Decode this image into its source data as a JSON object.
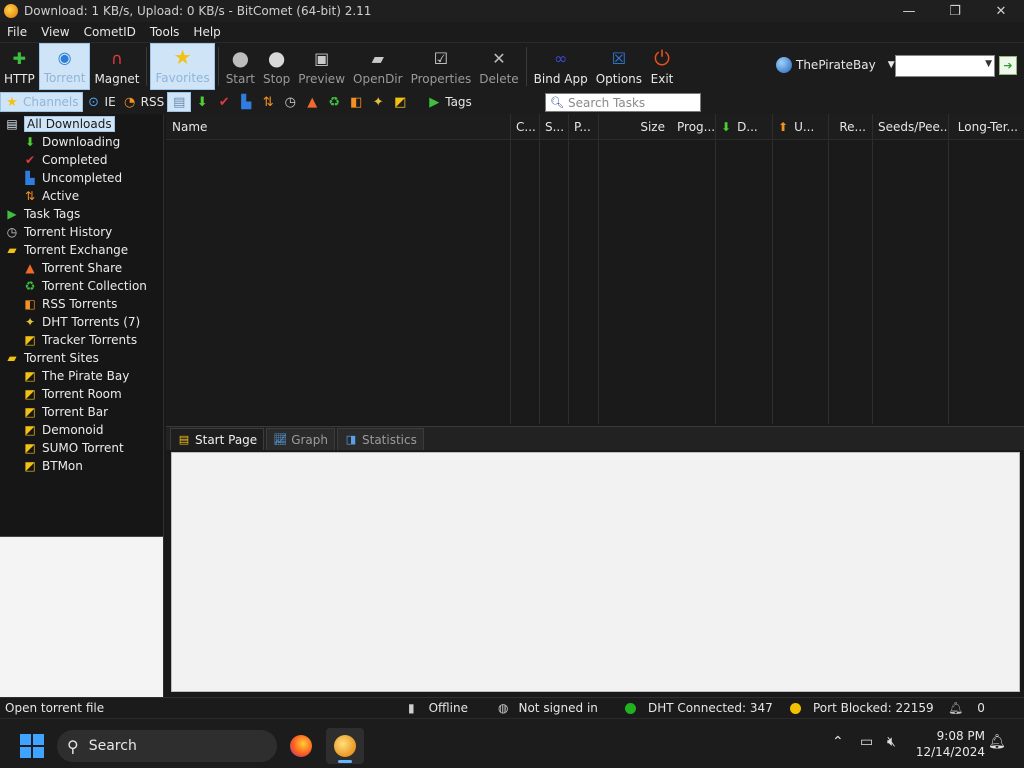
{
  "window": {
    "title": "Download: 1 KB/s, Upload: 0 KB/s - BitComet (64-bit) 2.11",
    "controls": [
      "—",
      "❐",
      "✕"
    ]
  },
  "menu": [
    "File",
    "View",
    "CometID",
    "Tools",
    "Help"
  ],
  "toolbar": {
    "buttons": [
      {
        "label": "HTTP",
        "icon": "http-add-icon"
      },
      {
        "label": "Torrent",
        "icon": "torrent-icon"
      },
      {
        "label": "Magnet",
        "icon": "magnet-icon"
      },
      {
        "label": "Favorites",
        "icon": "star-icon"
      },
      {
        "label": "Start",
        "icon": "play-icon"
      },
      {
        "label": "Stop",
        "icon": "stop-icon"
      },
      {
        "label": "Preview",
        "icon": "preview-icon"
      },
      {
        "label": "OpenDir",
        "icon": "folder-icon"
      },
      {
        "label": "Properties",
        "icon": "properties-icon"
      },
      {
        "label": "Delete",
        "icon": "delete-icon"
      },
      {
        "label": "Bind App",
        "icon": "bind-app-icon"
      },
      {
        "label": "Options",
        "icon": "options-icon"
      },
      {
        "label": "Exit",
        "icon": "exit-icon"
      }
    ],
    "site_select": "ThePirateBay",
    "site_search_value": ""
  },
  "subbar": {
    "channels": "Channels",
    "ie": "IE",
    "rss": "RSS",
    "tags": "Tags",
    "search_placeholder": "Search Tasks"
  },
  "sidebar": {
    "all_downloads": "All Downloads",
    "downloading": "Downloading",
    "completed": "Completed",
    "uncompleted": "Uncompleted",
    "active": "Active",
    "task_tags": "Task Tags",
    "torrent_history": "Torrent History",
    "torrent_exchange": "Torrent Exchange",
    "torrent_share": "Torrent Share",
    "torrent_collection": "Torrent Collection",
    "rss_torrents": "RSS Torrents",
    "dht_torrents": "DHT Torrents (7)",
    "tracker_torrents": "Tracker Torrents",
    "torrent_sites": "Torrent Sites",
    "the_pirate_bay": "The Pirate Bay",
    "torrent_room": "Torrent Room",
    "torrent_bar": "Torrent Bar",
    "demonoid": "Demonoid",
    "sumo_torrent": "SUMO Torrent",
    "btmon": "BTMon"
  },
  "tasklist": {
    "columns": [
      "Name",
      "C...",
      "S...",
      "P...",
      "Size",
      "Prog...",
      "D...",
      "U...",
      "Re...",
      "Seeds/Pee...",
      "Long-Ter..."
    ]
  },
  "tabs": [
    "Start Page",
    "Graph",
    "Statistics"
  ],
  "status": {
    "hint": "Open torrent file",
    "connection": "Offline",
    "sign_in": "Not signed in",
    "dht": "DHT Connected: 347",
    "port": "Port Blocked: 22159",
    "notifications": "0"
  },
  "taskbar": {
    "search_label": "Search",
    "time": "9:08 PM",
    "date": "12/14/2024"
  },
  "colors": {
    "accent": "#3fa3ff",
    "selection": "#cfe4f7",
    "dht_ok": "#1fb31f",
    "port_warn": "#f2c200"
  }
}
